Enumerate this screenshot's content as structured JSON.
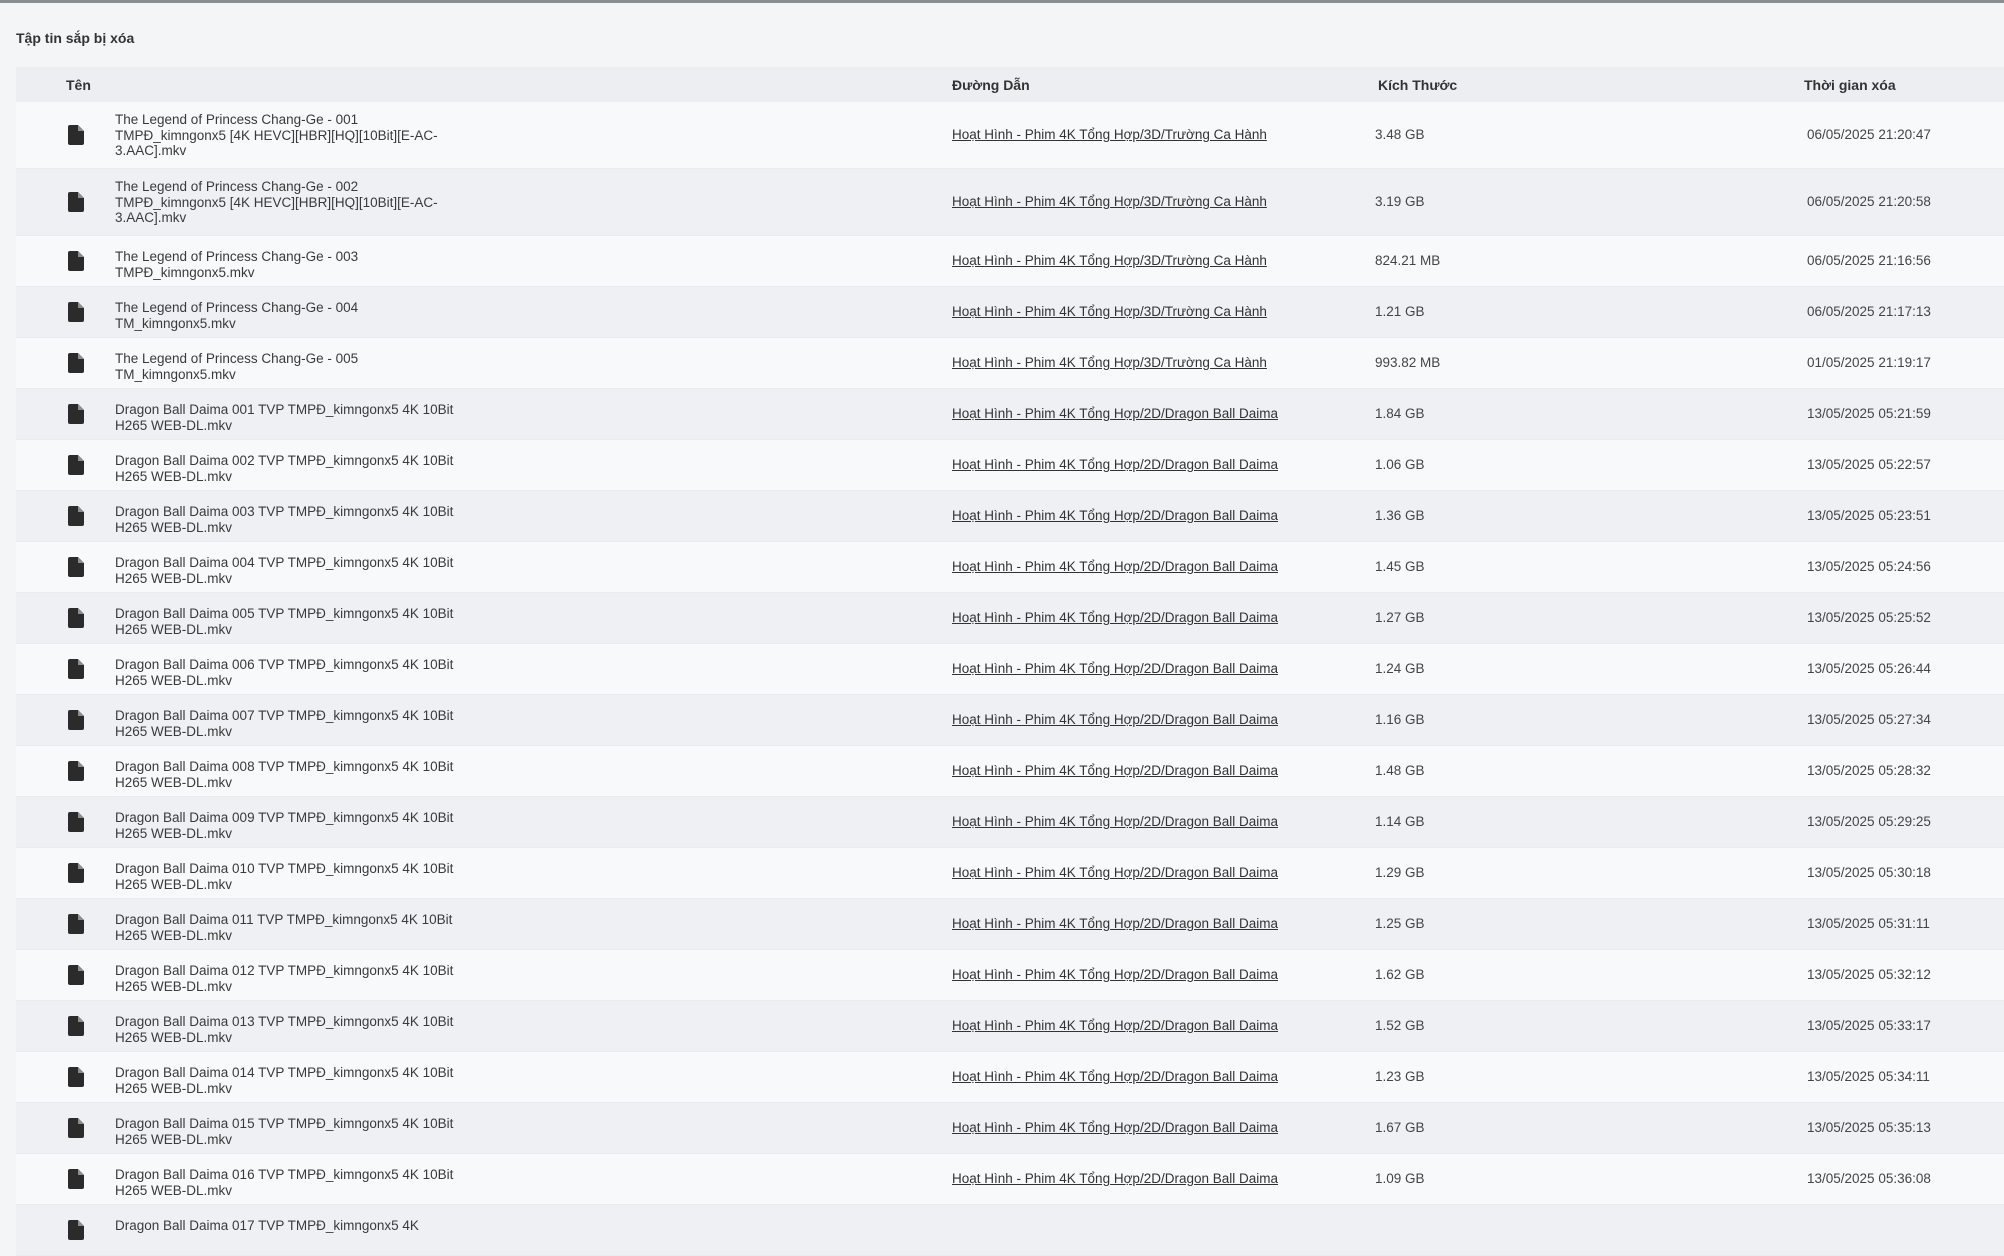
{
  "title": "Tập tin sắp bị xóa",
  "columns": {
    "name": "Tên",
    "path": "Đường Dẫn",
    "size": "Kích Thước",
    "time": "Thời gian xóa"
  },
  "icons": {
    "file": "file-icon"
  },
  "rows": [
    {
      "name": "The Legend of Princess Chang-Ge - 001 TMPĐ_kimngonx5 [4K HEVC][HBR][HQ][10Bit][E-AC-3.AAC].mkv",
      "path": "Hoạt Hình - Phim 4K Tổng Hợp/3D/Trường Ca Hành",
      "size": "3.48 GB",
      "time": "06/05/2025 21:20:47"
    },
    {
      "name": "The Legend of Princess Chang-Ge - 002 TMPĐ_kimngonx5 [4K HEVC][HBR][HQ][10Bit][E-AC-3.AAC].mkv",
      "path": "Hoạt Hình - Phim 4K Tổng Hợp/3D/Trường Ca Hành",
      "size": "3.19 GB",
      "time": "06/05/2025 21:20:58"
    },
    {
      "name": "The Legend of Princess Chang-Ge - 003 TMPĐ_kimngonx5.mkv",
      "path": "Hoạt Hình - Phim 4K Tổng Hợp/3D/Trường Ca Hành",
      "size": "824.21 MB",
      "time": "06/05/2025 21:16:56"
    },
    {
      "name": "The Legend of Princess Chang-Ge - 004 TM_kimngonx5.mkv",
      "path": "Hoạt Hình - Phim 4K Tổng Hợp/3D/Trường Ca Hành",
      "size": "1.21 GB",
      "time": "06/05/2025 21:17:13"
    },
    {
      "name": "The Legend of Princess Chang-Ge - 005 TM_kimngonx5.mkv",
      "path": "Hoạt Hình - Phim 4K Tổng Hợp/3D/Trường Ca Hành",
      "size": "993.82 MB",
      "time": "01/05/2025 21:19:17"
    },
    {
      "name": "Dragon Ball Daima 001 TVP TMPĐ_kimngonx5 4K 10Bit H265 WEB-DL.mkv",
      "path": "Hoạt Hình - Phim 4K Tổng Hợp/2D/Dragon Ball Daima",
      "size": "1.84 GB",
      "time": "13/05/2025 05:21:59"
    },
    {
      "name": "Dragon Ball Daima 002 TVP TMPĐ_kimngonx5 4K 10Bit H265 WEB-DL.mkv",
      "path": "Hoạt Hình - Phim 4K Tổng Hợp/2D/Dragon Ball Daima",
      "size": "1.06 GB",
      "time": "13/05/2025 05:22:57"
    },
    {
      "name": "Dragon Ball Daima 003 TVP TMPĐ_kimngonx5 4K 10Bit H265 WEB-DL.mkv",
      "path": "Hoạt Hình - Phim 4K Tổng Hợp/2D/Dragon Ball Daima",
      "size": "1.36 GB",
      "time": "13/05/2025 05:23:51"
    },
    {
      "name": "Dragon Ball Daima 004 TVP TMPĐ_kimngonx5 4K 10Bit H265 WEB-DL.mkv",
      "path": "Hoạt Hình - Phim 4K Tổng Hợp/2D/Dragon Ball Daima",
      "size": "1.45 GB",
      "time": "13/05/2025 05:24:56"
    },
    {
      "name": "Dragon Ball Daima 005 TVP TMPĐ_kimngonx5 4K 10Bit H265 WEB-DL.mkv",
      "path": "Hoạt Hình - Phim 4K Tổng Hợp/2D/Dragon Ball Daima",
      "size": "1.27 GB",
      "time": "13/05/2025 05:25:52"
    },
    {
      "name": "Dragon Ball Daima 006 TVP TMPĐ_kimngonx5 4K 10Bit H265 WEB-DL.mkv",
      "path": "Hoạt Hình - Phim 4K Tổng Hợp/2D/Dragon Ball Daima",
      "size": "1.24 GB",
      "time": "13/05/2025 05:26:44"
    },
    {
      "name": "Dragon Ball Daima 007 TVP TMPĐ_kimngonx5 4K 10Bit H265 WEB-DL.mkv",
      "path": "Hoạt Hình - Phim 4K Tổng Hợp/2D/Dragon Ball Daima",
      "size": "1.16 GB",
      "time": "13/05/2025 05:27:34"
    },
    {
      "name": "Dragon Ball Daima 008 TVP TMPĐ_kimngonx5 4K 10Bit H265 WEB-DL.mkv",
      "path": "Hoạt Hình - Phim 4K Tổng Hợp/2D/Dragon Ball Daima",
      "size": "1.48 GB",
      "time": "13/05/2025 05:28:32"
    },
    {
      "name": "Dragon Ball Daima 009 TVP TMPĐ_kimngonx5 4K 10Bit H265 WEB-DL.mkv",
      "path": "Hoạt Hình - Phim 4K Tổng Hợp/2D/Dragon Ball Daima",
      "size": "1.14 GB",
      "time": "13/05/2025 05:29:25"
    },
    {
      "name": "Dragon Ball Daima 010 TVP TMPĐ_kimngonx5 4K 10Bit H265 WEB-DL.mkv",
      "path": "Hoạt Hình - Phim 4K Tổng Hợp/2D/Dragon Ball Daima",
      "size": "1.29 GB",
      "time": "13/05/2025 05:30:18"
    },
    {
      "name": "Dragon Ball Daima 011 TVP TMPĐ_kimngonx5 4K 10Bit H265 WEB-DL.mkv",
      "path": "Hoạt Hình - Phim 4K Tổng Hợp/2D/Dragon Ball Daima",
      "size": "1.25 GB",
      "time": "13/05/2025 05:31:11"
    },
    {
      "name": "Dragon Ball Daima 012 TVP TMPĐ_kimngonx5 4K 10Bit H265 WEB-DL.mkv",
      "path": "Hoạt Hình - Phim 4K Tổng Hợp/2D/Dragon Ball Daima",
      "size": "1.62 GB",
      "time": "13/05/2025 05:32:12"
    },
    {
      "name": "Dragon Ball Daima 013 TVP TMPĐ_kimngonx5 4K 10Bit H265 WEB-DL.mkv",
      "path": "Hoạt Hình - Phim 4K Tổng Hợp/2D/Dragon Ball Daima",
      "size": "1.52 GB",
      "time": "13/05/2025 05:33:17"
    },
    {
      "name": "Dragon Ball Daima 014 TVP TMPĐ_kimngonx5 4K 10Bit H265 WEB-DL.mkv",
      "path": "Hoạt Hình - Phim 4K Tổng Hợp/2D/Dragon Ball Daima",
      "size": "1.23 GB",
      "time": "13/05/2025 05:34:11"
    },
    {
      "name": "Dragon Ball Daima 015 TVP TMPĐ_kimngonx5 4K 10Bit H265 WEB-DL.mkv",
      "path": "Hoạt Hình - Phim 4K Tổng Hợp/2D/Dragon Ball Daima",
      "size": "1.67 GB",
      "time": "13/05/2025 05:35:13"
    },
    {
      "name": "Dragon Ball Daima 016 TVP TMPĐ_kimngonx5 4K 10Bit H265 WEB-DL.mkv",
      "path": "Hoạt Hình - Phim 4K Tổng Hợp/2D/Dragon Ball Daima",
      "size": "1.09 GB",
      "time": "13/05/2025 05:36:08"
    },
    {
      "name": "Dragon Ball Daima 017 TVP TMPĐ_kimngonx5 4K",
      "path": "",
      "size": "",
      "time": ""
    }
  ]
}
